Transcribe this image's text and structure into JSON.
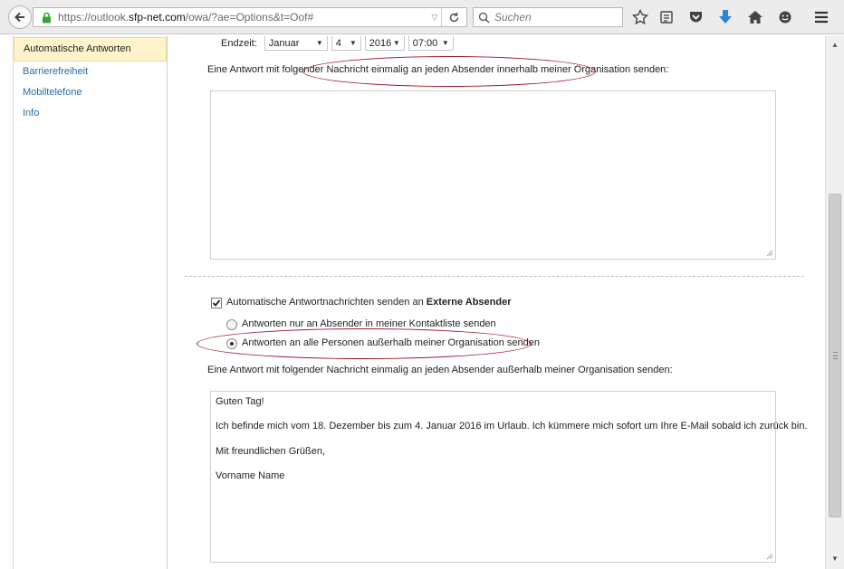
{
  "browser": {
    "url_prefix": "https://outlook.",
    "url_domain": "sfp-net.com",
    "url_suffix": "/owa/?ae=Options&t=Oof#",
    "search_placeholder": "Suchen"
  },
  "sidebar": {
    "items": [
      {
        "label": "Automatische Antworten",
        "active": true
      },
      {
        "label": "Barrierefreiheit"
      },
      {
        "label": "Mobiltelefone"
      },
      {
        "label": "Info"
      }
    ]
  },
  "endzeit": {
    "label": "Endzeit:",
    "month": "Januar",
    "day": "4",
    "year": "2016",
    "time": "07:00"
  },
  "internal": {
    "instruction": "Eine Antwort mit folgender Nachricht einmalig an jeden Absender innerhalb meiner Organisation senden:",
    "message": ""
  },
  "external": {
    "checkbox_label_prefix": "Automatische Antwortnachrichten senden an",
    "checkbox_label_bold": "Externe Absender",
    "checked": true,
    "radio_contacts": "Antworten nur an Absender in meiner Kontaktliste senden",
    "radio_all": "Antworten an alle Personen außerhalb meiner Organisation senden",
    "selected": "all",
    "instruction": "Eine Antwort mit folgender Nachricht einmalig an jeden Absender außerhalb meiner Organisation senden:",
    "message_lines": [
      "Guten Tag!",
      "Ich befinde mich vom 18. Dezember bis zum 4. Januar 2016 im Urlaub. Ich kümmere mich sofort um Ihre E-Mail sobald ich zurück bin.",
      "Mit freundlichen Grüßen,",
      "Vorname Name"
    ]
  },
  "colors": {
    "annotation": "#9c1c2c",
    "active_item_bg": "#fff3cc",
    "link": "#2b6aa6"
  }
}
